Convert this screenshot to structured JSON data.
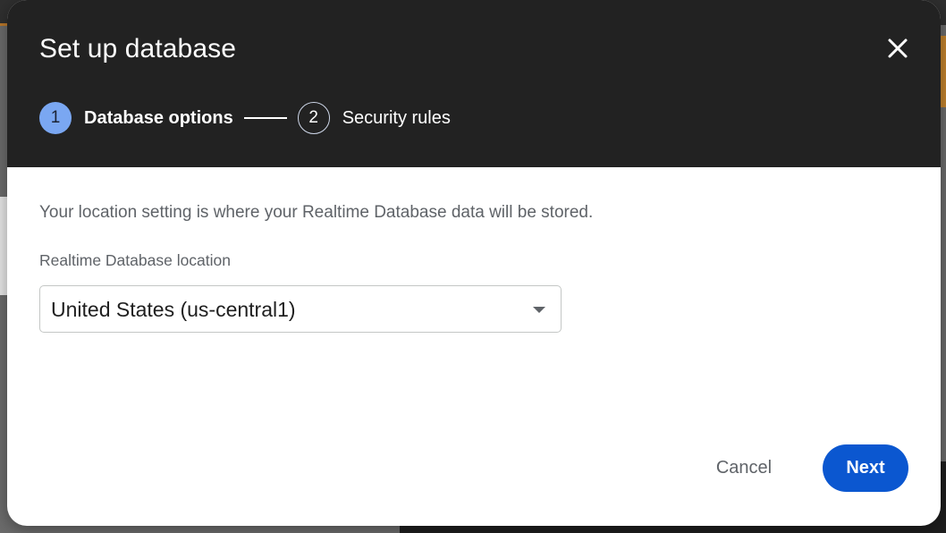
{
  "dialog": {
    "title": "Set up database",
    "close_icon": "close-icon"
  },
  "stepper": {
    "steps": [
      {
        "number": "1",
        "label": "Database options",
        "active": true
      },
      {
        "number": "2",
        "label": "Security rules",
        "active": false
      }
    ]
  },
  "body": {
    "description": "Your location setting is where your Realtime Database data will be stored.",
    "location_label": "Realtime Database location",
    "location_value": "United States (us-central1)"
  },
  "actions": {
    "cancel_label": "Cancel",
    "next_label": "Next"
  },
  "colors": {
    "header_bg": "#222222",
    "active_step": "#7aa7f2",
    "primary_button": "#0b57d0"
  }
}
